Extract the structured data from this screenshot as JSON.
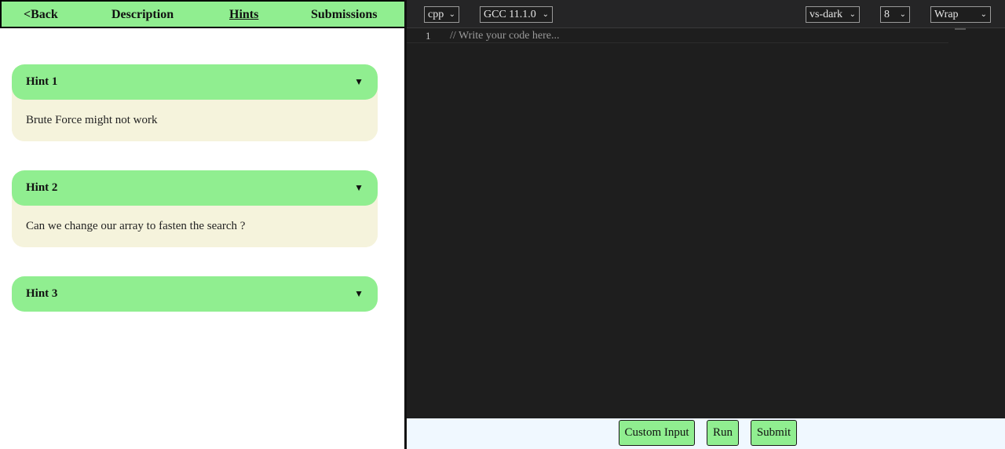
{
  "nav": {
    "back": "<Back",
    "description": "Description",
    "hints": "Hints",
    "submissions": "Submissions"
  },
  "hints": [
    {
      "title": "Hint 1",
      "body": "Brute Force might not work",
      "expanded": true
    },
    {
      "title": "Hint 2",
      "body": "Can we change our array to fasten the search ?",
      "expanded": true
    },
    {
      "title": "Hint 3",
      "body": "",
      "expanded": false
    }
  ],
  "caret_symbol": "▼",
  "toolbar": {
    "language": "cpp",
    "compiler": "GCC 11.1.0",
    "theme": "vs-dark",
    "font_size": "8",
    "wrap": "Wrap"
  },
  "editor": {
    "line_number": "1",
    "placeholder": "// Write your code here..."
  },
  "actions": {
    "custom_input": "Custom Input",
    "run": "Run",
    "submit": "Submit"
  },
  "colors": {
    "accent_green": "#90ee90",
    "hint_body_bg": "#f5f3dc",
    "editor_bg": "#1e1e1e",
    "action_bar_bg": "#f0f8ff"
  }
}
